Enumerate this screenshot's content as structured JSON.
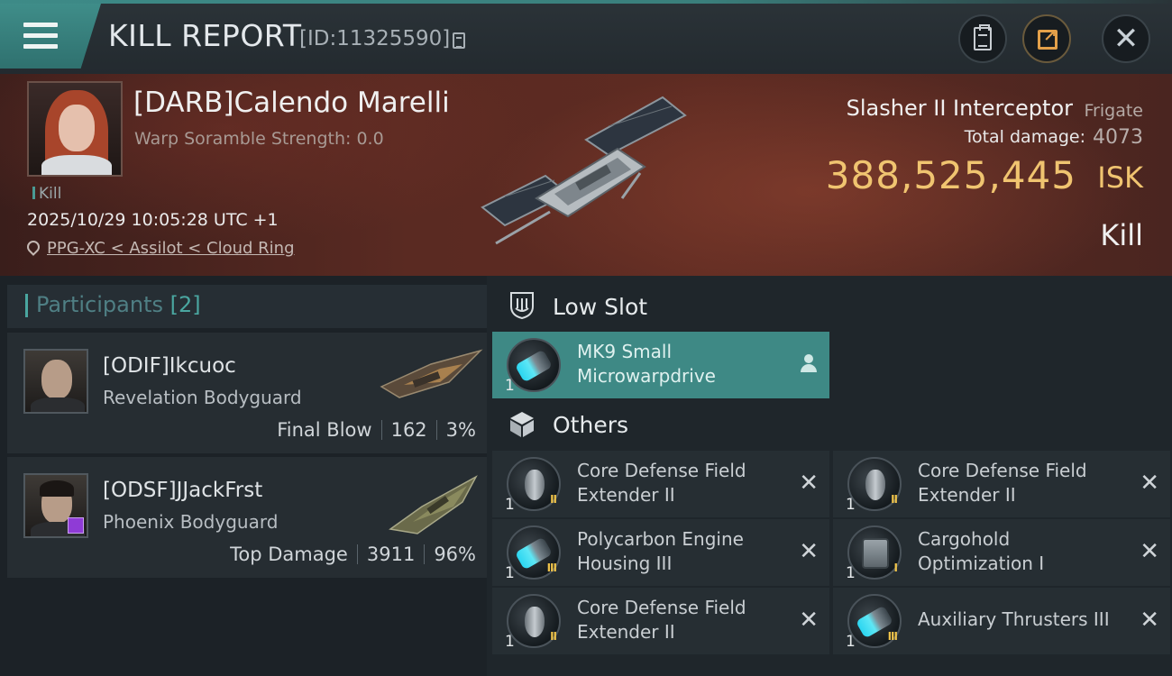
{
  "header": {
    "title": "KILL REPORT",
    "report_id": "[ID:11325590]"
  },
  "victim": {
    "name": "[DARB]Calendo Marelli",
    "warp_scramble": "Warp Soramble Strength: 0.0",
    "tag": "Kill",
    "datetime": "2025/10/29 10:05:28 UTC +1",
    "location": "PPG-XC < Assilot < Cloud Ring",
    "ship_name": "Slasher II Interceptor",
    "ship_class": "Frigate",
    "total_damage_label": "Total damage:",
    "total_damage": "4073",
    "isk_value": "388,525,445",
    "isk_unit": "ISK",
    "result": "Kill"
  },
  "participants": {
    "label": "Participants",
    "count": "[2]",
    "list": [
      {
        "name": "[ODIF]Ikcuoc",
        "ship": "Revelation Bodyguard",
        "role": "Final Blow",
        "damage": "162",
        "percent": "3%"
      },
      {
        "name": "[ODSF]JJackFrst",
        "ship": "Phoenix Bodyguard",
        "role": "Top Damage",
        "damage": "3911",
        "percent": "96%"
      }
    ]
  },
  "fittings": {
    "low_slot_label": "Low Slot",
    "others_label": "Others",
    "low_slot": [
      {
        "qty": "1",
        "line1": "MK9 Small",
        "line2": "Microwarpdrive",
        "icon": "thruster-icon",
        "tier": ""
      }
    ],
    "others": [
      {
        "qty": "1",
        "line1": "Core Defense Field",
        "line2": "Extender II",
        "icon": "shield-extender-icon",
        "tier": "II"
      },
      {
        "qty": "1",
        "line1": "Core Defense Field",
        "line2": "Extender II",
        "icon": "shield-extender-icon",
        "tier": "II"
      },
      {
        "qty": "1",
        "line1": "Polycarbon Engine",
        "line2": "Housing III",
        "icon": "thruster-icon",
        "tier": "III"
      },
      {
        "qty": "1",
        "line1": "Cargohold",
        "line2": "Optimization I",
        "icon": "cargohold-icon",
        "tier": "I"
      },
      {
        "qty": "1",
        "line1": "Core Defense Field",
        "line2": "Extender II",
        "icon": "shield-extender-icon",
        "tier": "II"
      },
      {
        "qty": "1",
        "line1": "Auxiliary Thrusters III",
        "line2": "",
        "icon": "thruster-icon",
        "tier": "III"
      }
    ]
  },
  "colors": {
    "accent_teal": "#3e8985",
    "isk_gold": "#f0c470",
    "victim_banner": "#5a2a22"
  }
}
